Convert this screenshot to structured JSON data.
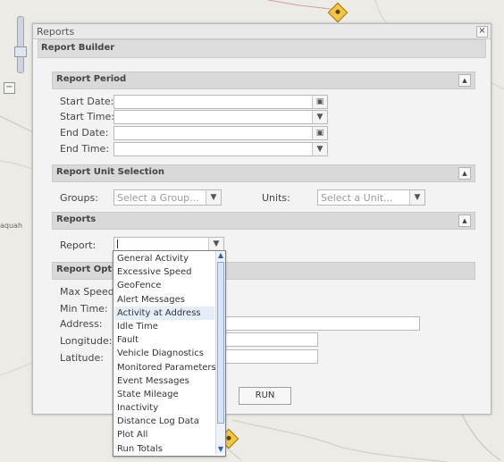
{
  "dialog": {
    "title": "Reports",
    "close_glyph": "×",
    "builder_title": "Report Builder"
  },
  "sections": {
    "period": "Report Period",
    "unit": "Report Unit Selection",
    "reports": "Reports",
    "options": "Report Options"
  },
  "period": {
    "start_date": "Start Date:",
    "start_time": "Start Time:",
    "end_date": "End Date:",
    "end_time": "End Time:"
  },
  "unit": {
    "groups_label": "Groups:",
    "groups_placeholder": "Select a Group...",
    "units_label": "Units:",
    "units_placeholder": "Select a Unit..."
  },
  "reports": {
    "report_label": "Report:",
    "report_value": ""
  },
  "options": {
    "max_speed": "Max Speed:",
    "min_time": "Min Time:",
    "address": "Address:",
    "longitude": "Longitude:",
    "latitude": "Latitude:",
    "run": "RUN"
  },
  "dropdown": {
    "items": [
      "General Activity",
      "Excessive Speed",
      "GeoFence",
      "Alert Messages",
      "Activity at Address",
      "Idle Time",
      "Fault",
      "Vehicle Diagnostics",
      "Monitored Parameters",
      "Event Messages",
      "State Mileage",
      "Inactivity",
      "Distance Log Data",
      "Plot All",
      "Run Totals"
    ],
    "selected_index": 4
  },
  "map": {
    "label": "aquah"
  },
  "icons": {
    "collapse": "▲",
    "calendar": "▣",
    "chevron": "▼",
    "minus": "−"
  }
}
